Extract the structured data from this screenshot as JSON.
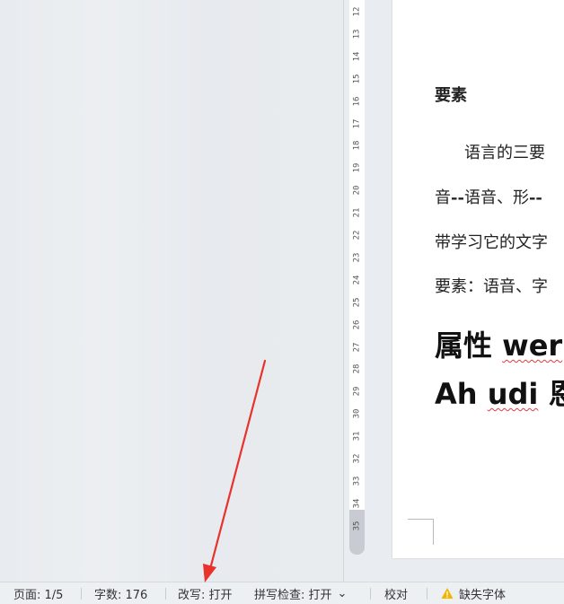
{
  "ruler": {
    "ticks": [
      "12",
      "13",
      "14",
      "15",
      "16",
      "17",
      "18",
      "19",
      "20",
      "21",
      "22",
      "23",
      "24",
      "25",
      "26",
      "27",
      "28",
      "29",
      "30",
      "31",
      "32",
      "33",
      "34",
      "35"
    ]
  },
  "document": {
    "heading": "要素",
    "line1": "语言的三要",
    "line2_a": "音",
    "line2_b": "--",
    "line2_c": "语音、形",
    "line2_d": "--",
    "line3": "带学习它的文字",
    "line4": "要素：语音、字",
    "line5_a": "属性 ",
    "line5_b": "wer",
    "line6_a": "Ah ",
    "line6_b": "udi",
    "line6_c": " 恩"
  },
  "status_bar": {
    "page": "页面: 1/5",
    "word_count": "字数: 176",
    "overwrite": "改写: 打开",
    "spell_check": "拼写检查: 打开",
    "spell_check_caret": "⌄",
    "proofread": "校对",
    "missing_fonts": "缺失字体"
  },
  "colors": {
    "accent_arrow": "#e8322b",
    "spell_underline": "#e03b3b",
    "warning": "#f5b400"
  },
  "icons": [
    "warning-icon",
    "chevron-down-icon"
  ]
}
